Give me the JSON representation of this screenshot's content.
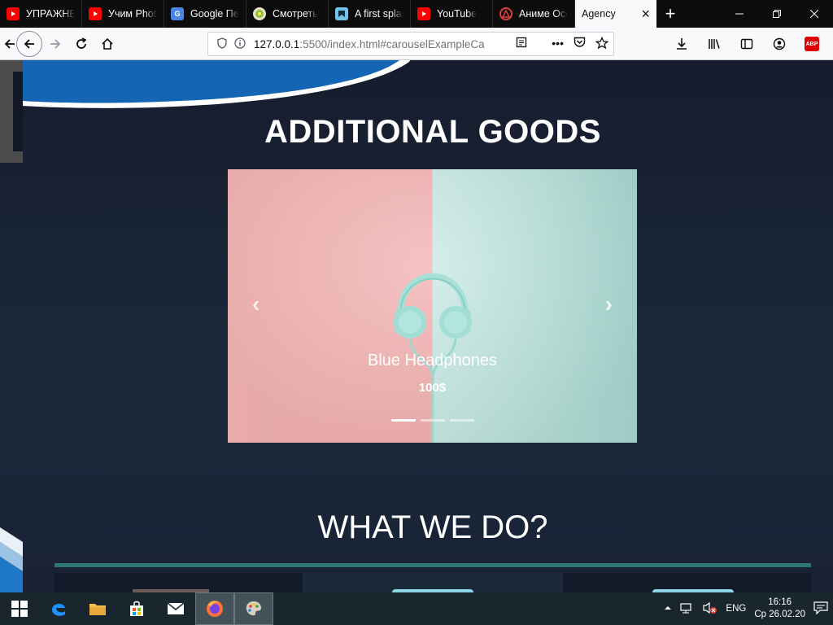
{
  "browser": {
    "tabs": [
      {
        "title": "УПРАЖНЕНИЯ",
        "icon": "youtube-icon"
      },
      {
        "title": "Учим Photoshop",
        "icon": "youtube-icon"
      },
      {
        "title": "Google Переводчик",
        "icon": "google-translate-icon"
      },
      {
        "title": "Смотреть",
        "icon": "globe-icon"
      },
      {
        "title": "A first splash",
        "icon": "bookmark-icon"
      },
      {
        "title": "YouTube",
        "icon": "youtube-icon"
      },
      {
        "title": "Аниме Осень",
        "icon": "anime-icon"
      },
      {
        "title": "Agency",
        "icon": "none",
        "active": true
      }
    ],
    "url_host": "127.0.0.1",
    "url_rest": ":5500/index.html#carouselExampleCa",
    "colors": {
      "tabstrip": "#0c0c0d",
      "active_tab": "#f9f9fb"
    }
  },
  "page": {
    "goods_title": "ADDITIONAL GOODS",
    "carousel": {
      "product_name": "Blue Headphones",
      "price": "100$",
      "slides": 3,
      "active_slide": 1
    },
    "what_we_do_title": "WHAT WE DO?",
    "colors": {
      "background": "#1b2234",
      "accent_line": "#2e7775",
      "wave": "#1565b5"
    }
  },
  "taskbar": {
    "language": "ENG",
    "time": "16:16",
    "date": "Ср 26.02.20"
  }
}
